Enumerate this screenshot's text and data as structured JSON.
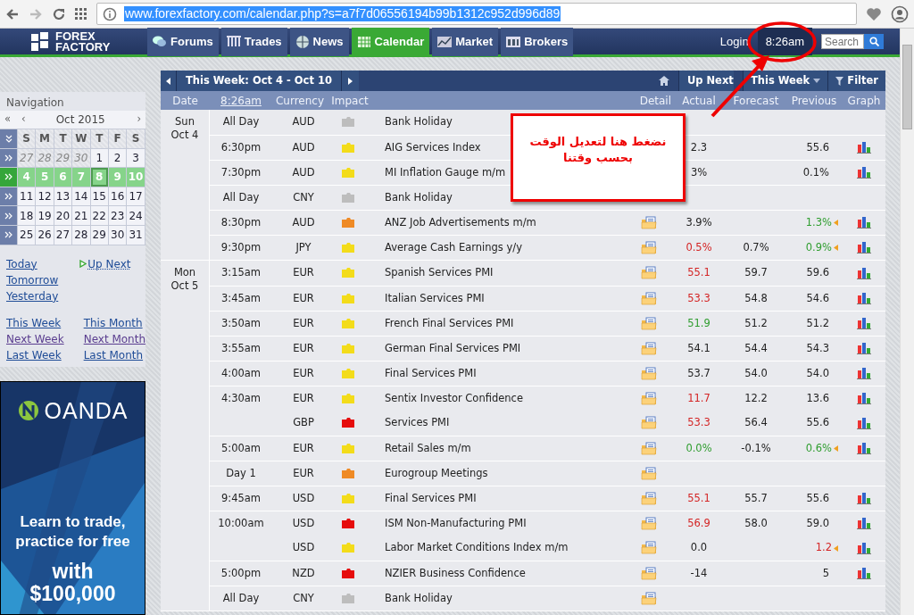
{
  "browser": {
    "url": "www.forexfactory.com/calendar.php?s=a7f7d06556194b99b1312c952d996d89"
  },
  "site": {
    "logo": [
      "FOREX",
      "FACTORY"
    ],
    "tabs": [
      {
        "label": "Forums",
        "selected": false
      },
      {
        "label": "Trades",
        "selected": false
      },
      {
        "label": "News",
        "selected": false
      },
      {
        "label": "Calendar",
        "selected": true
      },
      {
        "label": "Market",
        "selected": false
      },
      {
        "label": "Brokers",
        "selected": false
      }
    ],
    "login": "Login",
    "time": "8:26am",
    "search": {
      "placeholder": "Search"
    }
  },
  "navigation": {
    "title": "Navigation",
    "month": "Oct 2015",
    "first": "«",
    "prev": "‹",
    "next": "›",
    "weekdays": [
      "S",
      "M",
      "T",
      "W",
      "T",
      "F",
      "S"
    ],
    "weeks": [
      {
        "selected": false,
        "days": [
          {
            "d": "27",
            "other": true
          },
          {
            "d": "28",
            "other": true
          },
          {
            "d": "29",
            "other": true
          },
          {
            "d": "30",
            "other": true
          },
          {
            "d": "1",
            "other": false
          },
          {
            "d": "2",
            "other": false
          },
          {
            "d": "3",
            "other": false
          }
        ]
      },
      {
        "selected": true,
        "days": [
          {
            "d": "4",
            "other": false
          },
          {
            "d": "5",
            "other": false
          },
          {
            "d": "6",
            "other": false
          },
          {
            "d": "7",
            "other": false
          },
          {
            "d": "8",
            "other": false,
            "today": true
          },
          {
            "d": "9",
            "other": false
          },
          {
            "d": "10",
            "other": false
          }
        ]
      },
      {
        "selected": false,
        "days": [
          {
            "d": "11",
            "other": false
          },
          {
            "d": "12",
            "other": false
          },
          {
            "d": "13",
            "other": false
          },
          {
            "d": "14",
            "other": false
          },
          {
            "d": "15",
            "other": false
          },
          {
            "d": "16",
            "other": false
          },
          {
            "d": "17",
            "other": false
          }
        ]
      },
      {
        "selected": false,
        "days": [
          {
            "d": "18",
            "other": false
          },
          {
            "d": "19",
            "other": false
          },
          {
            "d": "20",
            "other": false
          },
          {
            "d": "21",
            "other": false
          },
          {
            "d": "22",
            "other": false
          },
          {
            "d": "23",
            "other": false
          },
          {
            "d": "24",
            "other": false
          }
        ]
      },
      {
        "selected": false,
        "days": [
          {
            "d": "25",
            "other": false
          },
          {
            "d": "26",
            "other": false
          },
          {
            "d": "27",
            "other": false
          },
          {
            "d": "28",
            "other": false
          },
          {
            "d": "29",
            "other": false
          },
          {
            "d": "30",
            "other": false
          },
          {
            "d": "31",
            "other": false
          }
        ]
      }
    ],
    "day_links": [
      [
        {
          "label": "Today",
          "visited": false
        },
        {
          "label": "Tomorrow",
          "visited": false
        },
        {
          "label": "Yesterday",
          "visited": false
        }
      ],
      [
        {
          "label": "Up Next",
          "visited": false,
          "kind": "upnext"
        }
      ]
    ],
    "period_links": [
      [
        {
          "label": "This Week",
          "visited": false
        },
        {
          "label": "Next Week",
          "visited": true
        },
        {
          "label": "Last Week",
          "visited": false
        }
      ],
      [
        {
          "label": "This Month",
          "visited": false
        },
        {
          "label": "Next Month",
          "visited": true
        },
        {
          "label": "Last Month",
          "visited": false
        }
      ]
    ]
  },
  "ad": {
    "brand": "OANDA",
    "lines": [
      "Learn to trade,",
      "practice for free"
    ],
    "offer": [
      "with",
      "$100,000"
    ]
  },
  "toolbar": {
    "range": "This Week: Oct 4 - Oct 10",
    "up_next": "Up Next",
    "period": "This Week",
    "filter": "Filter"
  },
  "columns": [
    "Date",
    "8:26am",
    "Currency",
    "Impact",
    "Detail",
    "Actual",
    "Forecast",
    "Previous",
    "Graph"
  ],
  "days": [
    {
      "day": "Sun",
      "date": "Oct 4",
      "events": [
        {
          "time": "All Day",
          "currency": "AUD",
          "color": "#bdbdbd",
          "title": "Bank Holiday",
          "detail": false,
          "graph": false
        },
        {
          "time": "6:30pm",
          "currency": "AUD",
          "color": "#f3dc1a",
          "title": "AIG Services Index",
          "detail": false,
          "actual": {
            "text": "2.3"
          },
          "previous": {
            "text": "55.6"
          },
          "graph": true
        },
        {
          "time": "7:30pm",
          "currency": "AUD",
          "color": "#f3dc1a",
          "title": "MI Inflation Gauge m/m",
          "detail": false,
          "actual": {
            "text": "3%"
          },
          "previous": {
            "text": "0.1%"
          },
          "graph": true
        },
        {
          "time": "All Day",
          "currency": "CNY",
          "color": "#bdbdbd",
          "title": "Bank Holiday",
          "detail": false,
          "graph": false
        },
        {
          "time": "8:30pm",
          "currency": "AUD",
          "color": "#ef8a25",
          "title": "ANZ Job Advertisements m/m",
          "detail": true,
          "actual": {
            "text": "3.9%"
          },
          "previous": {
            "text": "1.3%",
            "color": "#2f9d2f"
          },
          "revised": true,
          "graph": true
        },
        {
          "time": "9:30pm",
          "currency": "JPY",
          "color": "#f3dc1a",
          "title": "Average Cash Earnings y/y",
          "detail": true,
          "actual": {
            "text": "0.5%",
            "color": "#d42424"
          },
          "forecast": "0.7%",
          "previous": {
            "text": "0.9%",
            "color": "#2f9d2f"
          },
          "revised": true,
          "graph": true
        }
      ]
    },
    {
      "day": "Mon",
      "date": "Oct 5",
      "events": [
        {
          "time": "3:15am",
          "currency": "EUR",
          "color": "#f3dc1a",
          "title": "Spanish Services PMI",
          "detail": true,
          "actual": {
            "text": "55.1",
            "color": "#d42424"
          },
          "forecast": "59.7",
          "previous": {
            "text": "59.6"
          },
          "graph": true
        },
        {
          "time": "3:45am",
          "currency": "EUR",
          "color": "#f3dc1a",
          "title": "Italian Services PMI",
          "detail": true,
          "actual": {
            "text": "53.3",
            "color": "#d42424"
          },
          "forecast": "54.8",
          "previous": {
            "text": "54.6"
          },
          "graph": true
        },
        {
          "time": "3:50am",
          "currency": "EUR",
          "color": "#f3dc1a",
          "title": "French Final Services PMI",
          "detail": true,
          "actual": {
            "text": "51.9",
            "color": "#2f9d2f"
          },
          "forecast": "51.2",
          "previous": {
            "text": "51.2"
          },
          "graph": true
        },
        {
          "time": "3:55am",
          "currency": "EUR",
          "color": "#f3dc1a",
          "title": "German Final Services PMI",
          "detail": true,
          "actual": {
            "text": "54.1"
          },
          "forecast": "54.4",
          "previous": {
            "text": "54.3"
          },
          "graph": true
        },
        {
          "time": "4:00am",
          "currency": "EUR",
          "color": "#f3dc1a",
          "title": "Final Services PMI",
          "detail": true,
          "actual": {
            "text": "53.7"
          },
          "forecast": "54.0",
          "previous": {
            "text": "54.0"
          },
          "graph": true
        },
        {
          "time": "4:30am",
          "currency": "EUR",
          "color": "#f3dc1a",
          "title": "Sentix Investor Confidence",
          "detail": true,
          "actual": {
            "text": "11.7",
            "color": "#d42424"
          },
          "forecast": "12.2",
          "previous": {
            "text": "13.6"
          },
          "graph": true
        },
        {
          "currency": "GBP",
          "color": "#e60c0c",
          "title": "Services PMI",
          "detail": true,
          "actual": {
            "text": "53.3",
            "color": "#d42424"
          },
          "forecast": "56.4",
          "previous": {
            "text": "55.6"
          },
          "graph": true
        },
        {
          "time": "5:00am",
          "currency": "EUR",
          "color": "#f3dc1a",
          "title": "Retail Sales m/m",
          "detail": true,
          "actual": {
            "text": "0.0%",
            "color": "#2f9d2f"
          },
          "forecast": "-0.1%",
          "previous": {
            "text": "0.6%",
            "color": "#2f9d2f"
          },
          "revised": true,
          "graph": true
        },
        {
          "time": "Day 1",
          "currency": "EUR",
          "color": "#ef8a25",
          "title": "Eurogroup Meetings",
          "detail": true,
          "graph": false
        },
        {
          "time": "9:45am",
          "currency": "USD",
          "color": "#f3dc1a",
          "title": "Final Services PMI",
          "detail": true,
          "actual": {
            "text": "55.1",
            "color": "#d42424"
          },
          "forecast": "55.7",
          "previous": {
            "text": "55.6"
          },
          "graph": true
        },
        {
          "time": "10:00am",
          "currency": "USD",
          "color": "#e60c0c",
          "title": "ISM Non-Manufacturing PMI",
          "detail": true,
          "actual": {
            "text": "56.9",
            "color": "#d42424"
          },
          "forecast": "58.0",
          "previous": {
            "text": "59.0"
          },
          "graph": true
        },
        {
          "currency": "USD",
          "color": "#f3dc1a",
          "title": "Labor Market Conditions Index m/m",
          "detail": true,
          "actual": {
            "text": "0.0"
          },
          "previous": {
            "text": "1.2",
            "color": "#d42424"
          },
          "revised": true,
          "graph": true
        },
        {
          "time": "5:00pm",
          "currency": "NZD",
          "color": "#e60c0c",
          "title": "NZIER Business Confidence",
          "detail": true,
          "actual": {
            "text": "-14"
          },
          "previous": {
            "text": "5"
          },
          "graph": true
        },
        {
          "time": "All Day",
          "currency": "CNY",
          "color": "#bdbdbd",
          "title": "Bank Holiday",
          "detail": true,
          "graph": false
        }
      ]
    }
  ],
  "annotation": {
    "text": "نضغط هنا لتعديل الوقت بحسب وقتنا"
  }
}
